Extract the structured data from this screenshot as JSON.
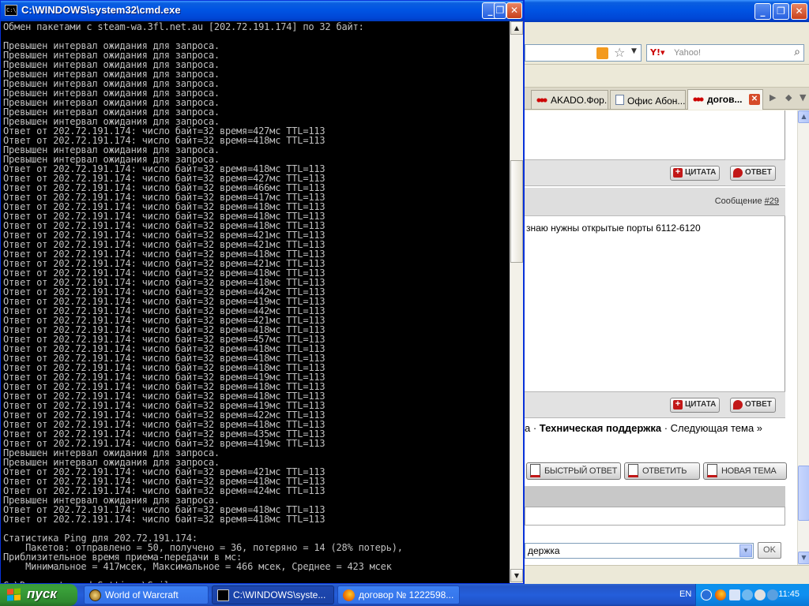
{
  "browser": {
    "search_placeholder": "Yahoo!",
    "tabs": [
      {
        "label": "AKADO.Фор..."
      },
      {
        "label": "Офис Абон..."
      },
      {
        "label": "догов..."
      }
    ],
    "quote_button": "ЦИТАТА",
    "reply_button": "ОТВЕТ",
    "message_label": "Сообщение",
    "message_number": "#29",
    "post_text": "знаю нужны открытые порты 6112-6120",
    "breadcrumb_prefix": "а ·",
    "breadcrumb_current": "Техническая поддержка",
    "breadcrumb_next": "· Следующая тема »",
    "actions": {
      "quick_reply": "Быстрый ответ",
      "reply": "Ответить",
      "new_topic": "Новая тема"
    },
    "forum_select_value": "держка",
    "ok_button": "OK"
  },
  "console": {
    "title": "C:\\WINDOWS\\system32\\cmd.exe",
    "lines": [
      "Обмен пакетами с steam-wa.3fl.net.au [202.72.191.174] по 32 байт:",
      "",
      "Превышен интервал ожидания для запроса.",
      "Превышен интервал ожидания для запроса.",
      "Превышен интервал ожидания для запроса.",
      "Превышен интервал ожидания для запроса.",
      "Превышен интервал ожидания для запроса.",
      "Превышен интервал ожидания для запроса.",
      "Превышен интервал ожидания для запроса.",
      "Превышен интервал ожидания для запроса.",
      "Превышен интервал ожидания для запроса.",
      "Ответ от 202.72.191.174: число байт=32 время=427мс TTL=113",
      "Ответ от 202.72.191.174: число байт=32 время=418мс TTL=113",
      "Превышен интервал ожидания для запроса.",
      "Превышен интервал ожидания для запроса.",
      "Ответ от 202.72.191.174: число байт=32 время=418мс TTL=113",
      "Ответ от 202.72.191.174: число байт=32 время=427мс TTL=113",
      "Ответ от 202.72.191.174: число байт=32 время=466мс TTL=113",
      "Ответ от 202.72.191.174: число байт=32 время=417мс TTL=113",
      "Ответ от 202.72.191.174: число байт=32 время=418мс TTL=113",
      "Ответ от 202.72.191.174: число байт=32 время=418мс TTL=113",
      "Ответ от 202.72.191.174: число байт=32 время=418мс TTL=113",
      "Ответ от 202.72.191.174: число байт=32 время=421мс TTL=113",
      "Ответ от 202.72.191.174: число байт=32 время=421мс TTL=113",
      "Ответ от 202.72.191.174: число байт=32 время=418мс TTL=113",
      "Ответ от 202.72.191.174: число байт=32 время=421мс TTL=113",
      "Ответ от 202.72.191.174: число байт=32 время=418мс TTL=113",
      "Ответ от 202.72.191.174: число байт=32 время=418мс TTL=113",
      "Ответ от 202.72.191.174: число байт=32 время=442мс TTL=113",
      "Ответ от 202.72.191.174: число байт=32 время=419мс TTL=113",
      "Ответ от 202.72.191.174: число байт=32 время=442мс TTL=113",
      "Ответ от 202.72.191.174: число байт=32 время=421мс TTL=113",
      "Ответ от 202.72.191.174: число байт=32 время=418мс TTL=113",
      "Ответ от 202.72.191.174: число байт=32 время=457мс TTL=113",
      "Ответ от 202.72.191.174: число байт=32 время=418мс TTL=113",
      "Ответ от 202.72.191.174: число байт=32 время=418мс TTL=113",
      "Ответ от 202.72.191.174: число байт=32 время=418мс TTL=113",
      "Ответ от 202.72.191.174: число байт=32 время=419мс TTL=113",
      "Ответ от 202.72.191.174: число байт=32 время=418мс TTL=113",
      "Ответ от 202.72.191.174: число байт=32 время=418мс TTL=113",
      "Ответ от 202.72.191.174: число байт=32 время=419мс TTL=113",
      "Ответ от 202.72.191.174: число байт=32 время=422мс TTL=113",
      "Ответ от 202.72.191.174: число байт=32 время=418мс TTL=113",
      "Ответ от 202.72.191.174: число байт=32 время=435мс TTL=113",
      "Ответ от 202.72.191.174: число байт=32 время=419мс TTL=113",
      "Превышен интервал ожидания для запроса.",
      "Превышен интервал ожидания для запроса.",
      "Ответ от 202.72.191.174: число байт=32 время=421мс TTL=113",
      "Ответ от 202.72.191.174: число байт=32 время=418мс TTL=113",
      "Ответ от 202.72.191.174: число байт=32 время=424мс TTL=113",
      "Превышен интервал ожидания для запроса.",
      "Ответ от 202.72.191.174: число байт=32 время=418мс TTL=113",
      "Ответ от 202.72.191.174: число байт=32 время=418мс TTL=113",
      "",
      "Статистика Ping для 202.72.191.174:",
      "    Пакетов: отправлено = 50, получено = 36, потеряно = 14 (28% потерь),",
      "Приблизительное время приема-передачи в мс:",
      "    Минимальное = 417мсек, Максимальное = 466 мсек, Среднее = 423 мсек",
      "",
      "C:\\Documents and Settings\\Smileman>"
    ]
  },
  "taskbar": {
    "start_label": "пуск",
    "tasks": [
      {
        "label": "World of Warcraft"
      },
      {
        "label": "C:\\WINDOWS\\syste..."
      },
      {
        "label": "договор № 1222598..."
      }
    ],
    "language": "EN",
    "clock": "11:45"
  },
  "colors": {
    "console_bg": "#000000",
    "console_fg": "#c0c0c0",
    "xp_blue": "#0054e3",
    "start_green": "#3aa13a",
    "accent_red": "#c21818"
  }
}
